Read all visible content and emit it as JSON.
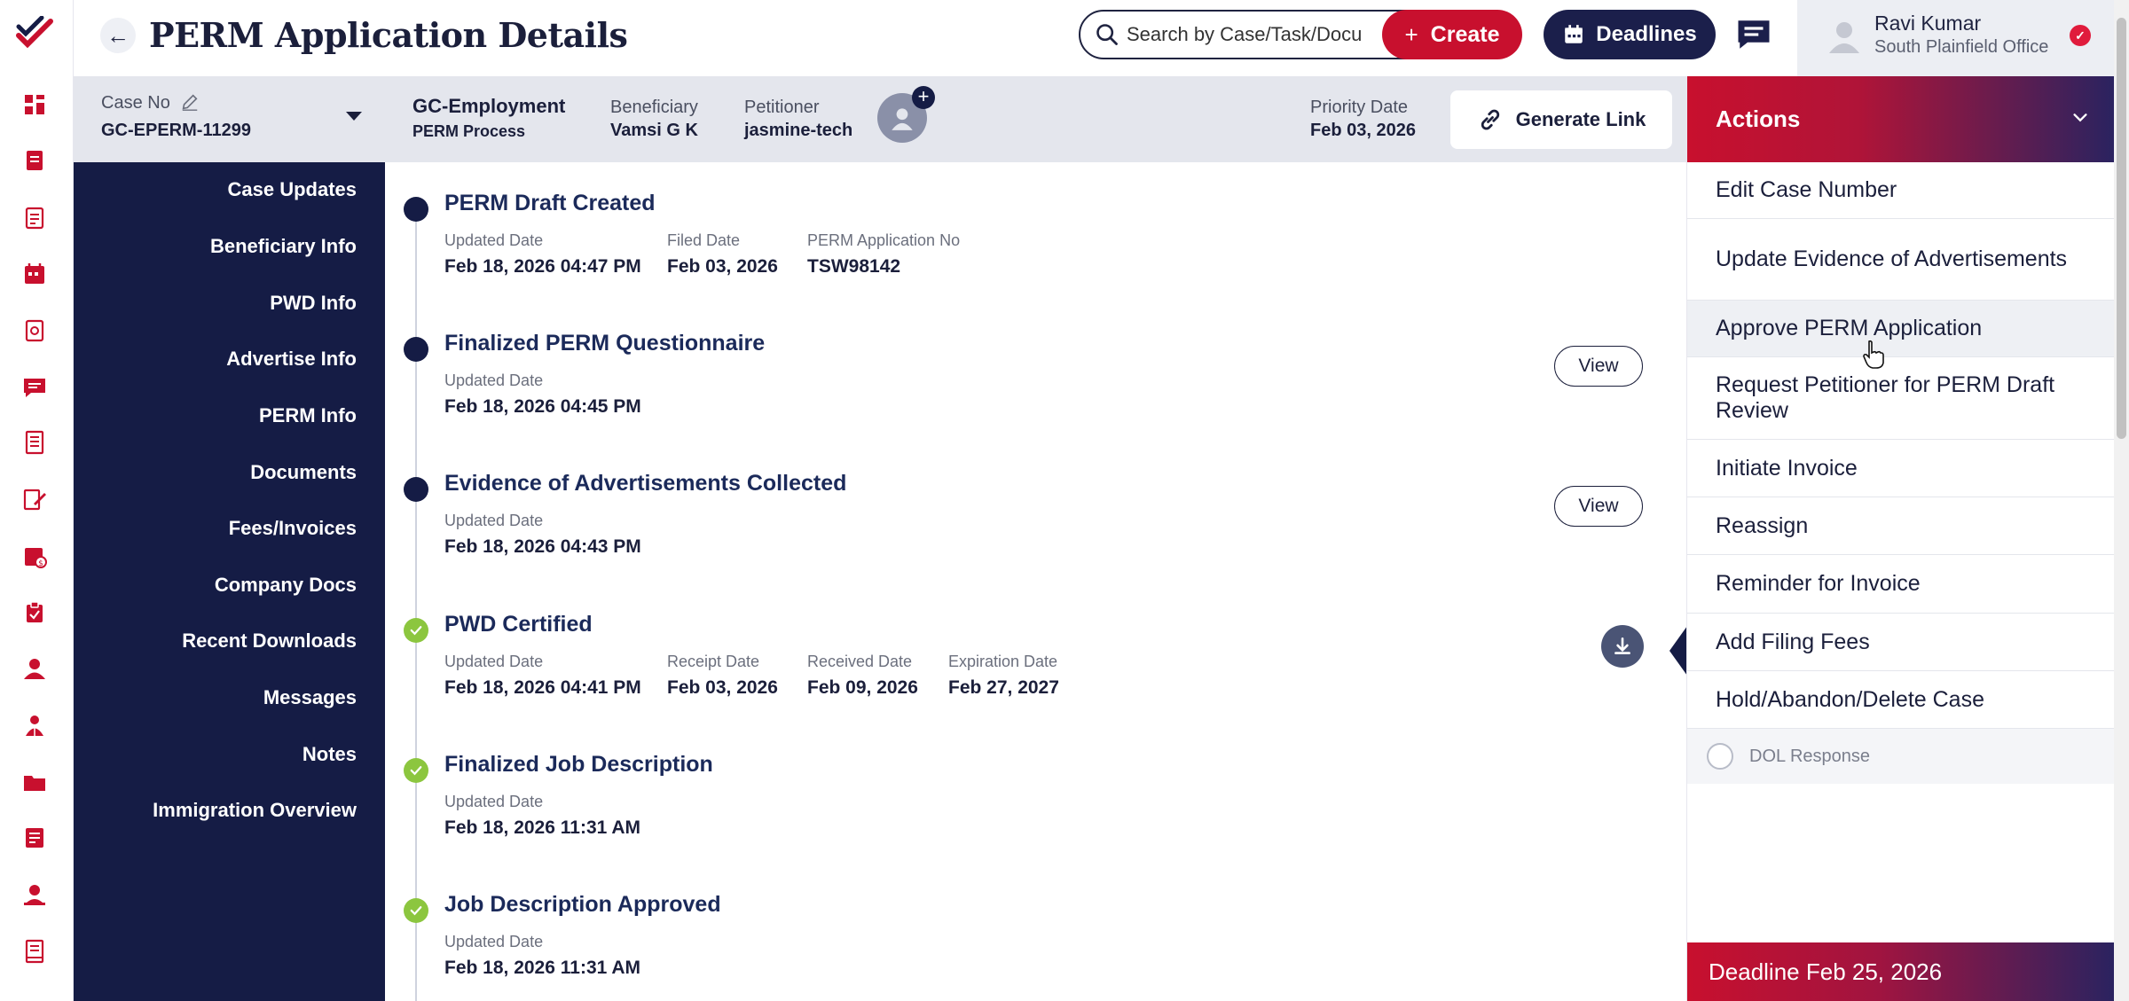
{
  "header": {
    "title": "PERM Application Details",
    "back_icon": "←",
    "search_placeholder": "Search by Case/Task/Docu",
    "create_label": "Create",
    "create_plus": "+",
    "deadlines_label": "Deadlines",
    "user_name": "Ravi Kumar",
    "user_office": "South Plainfield Office",
    "notif_glyph": "✓"
  },
  "case": {
    "case_no_label": "Case No",
    "case_no": "GC-EPERM-11299",
    "case_type": "GC-Employment",
    "case_process": "PERM Process",
    "beneficiary_label": "Beneficiary",
    "beneficiary": "Vamsi G K",
    "petitioner_label": "Petitioner",
    "petitioner": "jasmine-tech",
    "priority_label": "Priority Date",
    "priority_date": "Feb 03, 2026",
    "generate_link": "Generate Link"
  },
  "sidenav": [
    "Case Updates",
    "Beneficiary Info",
    "PWD Info",
    "Advertise Info",
    "PERM Info",
    "Documents",
    "Fees/Invoices",
    "Company Docs",
    "Recent Downloads",
    "Messages",
    "Notes",
    "Immigration Overview"
  ],
  "timeline": {
    "view_label": "View",
    "items": [
      {
        "title": "PERM Draft Created",
        "status": "in-progress",
        "fields": [
          {
            "label": "Updated Date",
            "value": "Feb 18, 2026 04:47 PM"
          },
          {
            "label": "Filed Date",
            "value": "Feb 03, 2026"
          },
          {
            "label": "PERM Application No",
            "value": "TSW98142"
          }
        ]
      },
      {
        "title": "Finalized PERM Questionnaire",
        "status": "in-progress",
        "fields": [
          {
            "label": "Updated Date",
            "value": "Feb 18, 2026 04:45 PM"
          }
        ]
      },
      {
        "title": "Evidence of Advertisements Collected",
        "status": "in-progress",
        "fields": [
          {
            "label": "Updated Date",
            "value": "Feb 18, 2026 04:43 PM"
          }
        ]
      },
      {
        "title": "PWD Certified",
        "status": "completed",
        "fields": [
          {
            "label": "Updated Date",
            "value": "Feb 18, 2026 04:41 PM"
          },
          {
            "label": "Receipt Date",
            "value": "Feb 03, 2026"
          },
          {
            "label": "Received Date",
            "value": "Feb 09, 2026"
          },
          {
            "label": "Expiration Date",
            "value": "Feb 27, 2027"
          }
        ]
      },
      {
        "title": "Finalized Job Description",
        "status": "completed",
        "fields": [
          {
            "label": "Updated Date",
            "value": "Feb 18, 2026 11:31 AM"
          }
        ]
      },
      {
        "title": "Job Description Approved",
        "status": "completed",
        "fields": [
          {
            "label": "Updated Date",
            "value": "Feb 18, 2026 11:31 AM"
          }
        ]
      }
    ]
  },
  "actions": {
    "title": "Actions",
    "items": [
      "Edit Case Number",
      "Update Evidence of Advertisements",
      "Approve PERM Application",
      "Request Petitioner for PERM Draft Review",
      "Initiate Invoice",
      "Reassign",
      "Reminder for Invoice",
      "Add Filing Fees",
      "Hold/Abandon/Delete Case"
    ],
    "hovered_index": 2,
    "dol_response": "DOL Response",
    "deadline": "Deadline Feb 25, 2026"
  },
  "colors": {
    "brand_red": "#c8102e",
    "navy": "#151c45",
    "completed_green": "#8cc63f"
  },
  "icons": {
    "rail": [
      "dashboard-icon",
      "cases-icon",
      "documents-icon",
      "calendar-icon",
      "reports-icon",
      "messages-icon",
      "forms-icon",
      "edit-doc-icon",
      "billing-icon",
      "tasks-icon",
      "user-icon",
      "contacts-icon",
      "folder-icon",
      "notes-icon",
      "profile-icon",
      "archive-icon"
    ]
  }
}
